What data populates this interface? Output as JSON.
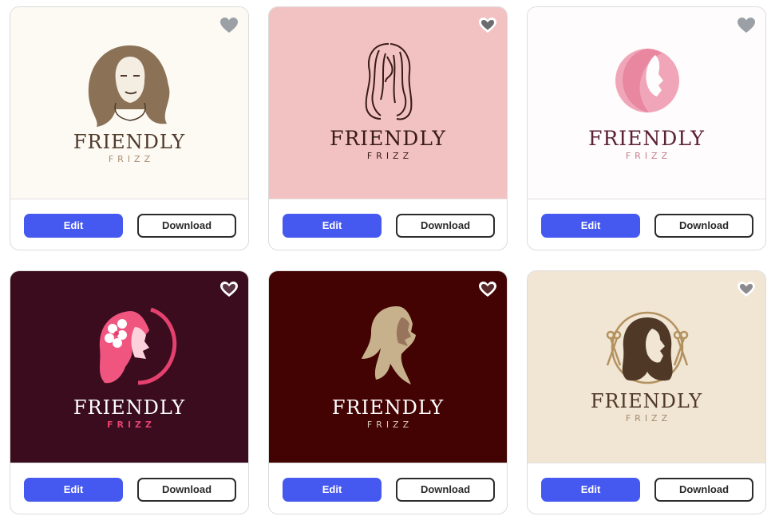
{
  "cards": [
    {
      "brand": "FRIENDLY",
      "sub": "FRIZZ",
      "bg": "#fdf9f3",
      "name_color": "#4e3a2b",
      "sub_color": "#a88f72",
      "heart_style": "solid-gray",
      "edit_label": "Edit",
      "download_label": "Download"
    },
    {
      "brand": "FRIENDLY",
      "sub": "FRIZZ",
      "bg": "#f2c2c2",
      "name_color": "#3a1c16",
      "sub_color": "#3a1c16",
      "heart_style": "outline-white",
      "edit_label": "Edit",
      "download_label": "Download"
    },
    {
      "brand": "FRIENDLY",
      "sub": "FRIZZ",
      "bg": "#fefcfc",
      "name_color": "#5b2134",
      "sub_color": "#c67b8a",
      "heart_style": "solid-gray",
      "edit_label": "Edit",
      "download_label": "Download"
    },
    {
      "brand": "FRIENDLY",
      "sub": "FRIZZ",
      "bg": "#3a0c1e",
      "name_color": "#ffffff",
      "sub_color": "#e5416f",
      "heart_style": "outline-white",
      "edit_label": "Edit",
      "download_label": "Download"
    },
    {
      "brand": "FRIENDLY",
      "sub": "FRIZZ",
      "bg": "#440303",
      "name_color": "#ffffff",
      "sub_color": "#d9c9b5",
      "heart_style": "outline-white",
      "edit_label": "Edit",
      "download_label": "Download"
    },
    {
      "brand": "FRIENDLY",
      "sub": "FRIZZ",
      "bg": "#f1e5d4",
      "name_color": "#4f3826",
      "sub_color": "#a48a6c",
      "heart_style": "outline-white",
      "edit_label": "Edit",
      "download_label": "Download"
    }
  ]
}
